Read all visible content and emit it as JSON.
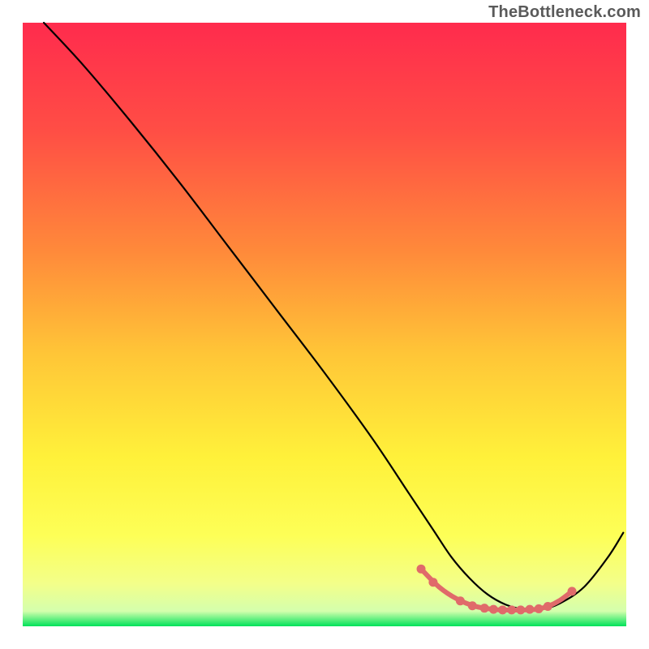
{
  "watermark": "TheBottleneck.com",
  "chart_data": {
    "type": "line",
    "title": "",
    "xlabel": "",
    "ylabel": "",
    "xlim": [
      0,
      100
    ],
    "ylim": [
      0,
      100
    ],
    "grid": false,
    "legend": false,
    "annotations": [],
    "gradient_stops": [
      {
        "offset": 0.0,
        "color": "#ff2b4d"
      },
      {
        "offset": 0.18,
        "color": "#ff4e45"
      },
      {
        "offset": 0.38,
        "color": "#ff8a3a"
      },
      {
        "offset": 0.55,
        "color": "#ffc637"
      },
      {
        "offset": 0.72,
        "color": "#fff13a"
      },
      {
        "offset": 0.85,
        "color": "#fdff57"
      },
      {
        "offset": 0.93,
        "color": "#f3ff8a"
      },
      {
        "offset": 0.975,
        "color": "#d4ffad"
      },
      {
        "offset": 1.0,
        "color": "#00e25a"
      }
    ],
    "series": [
      {
        "name": "curve",
        "color": "#000000",
        "x": [
          3.5,
          10,
          18,
          26,
          34,
          42,
          50,
          58,
          64,
          68,
          71,
          74,
          77,
          80,
          83,
          86,
          89,
          93,
          97,
          99.5
        ],
        "y": [
          100,
          93,
          83.5,
          73.5,
          63,
          52.5,
          42,
          31,
          22,
          16,
          11.5,
          8,
          5.3,
          3.6,
          2.8,
          2.8,
          3.8,
          6.5,
          11.5,
          15.5
        ]
      },
      {
        "name": "bottom-highlight",
        "color": "#e06a6a",
        "x": [
          66,
          69,
          72,
          75,
          78,
          80,
          82.5,
          85,
          87,
          89,
          91
        ],
        "y": [
          9.5,
          6.5,
          4.5,
          3.3,
          2.8,
          2.7,
          2.7,
          2.8,
          3.3,
          4.3,
          5.8
        ]
      }
    ],
    "bottom_dots": {
      "color": "#e06a6a",
      "points": [
        {
          "x": 66,
          "y": 9.5
        },
        {
          "x": 68,
          "y": 7.3
        },
        {
          "x": 72.5,
          "y": 4.2
        },
        {
          "x": 74.5,
          "y": 3.4
        },
        {
          "x": 76.5,
          "y": 3.0
        },
        {
          "x": 78,
          "y": 2.8
        },
        {
          "x": 79.5,
          "y": 2.7
        },
        {
          "x": 81,
          "y": 2.7
        },
        {
          "x": 82.5,
          "y": 2.7
        },
        {
          "x": 84,
          "y": 2.8
        },
        {
          "x": 85.5,
          "y": 2.9
        },
        {
          "x": 87,
          "y": 3.3
        },
        {
          "x": 91,
          "y": 5.8
        }
      ]
    }
  }
}
